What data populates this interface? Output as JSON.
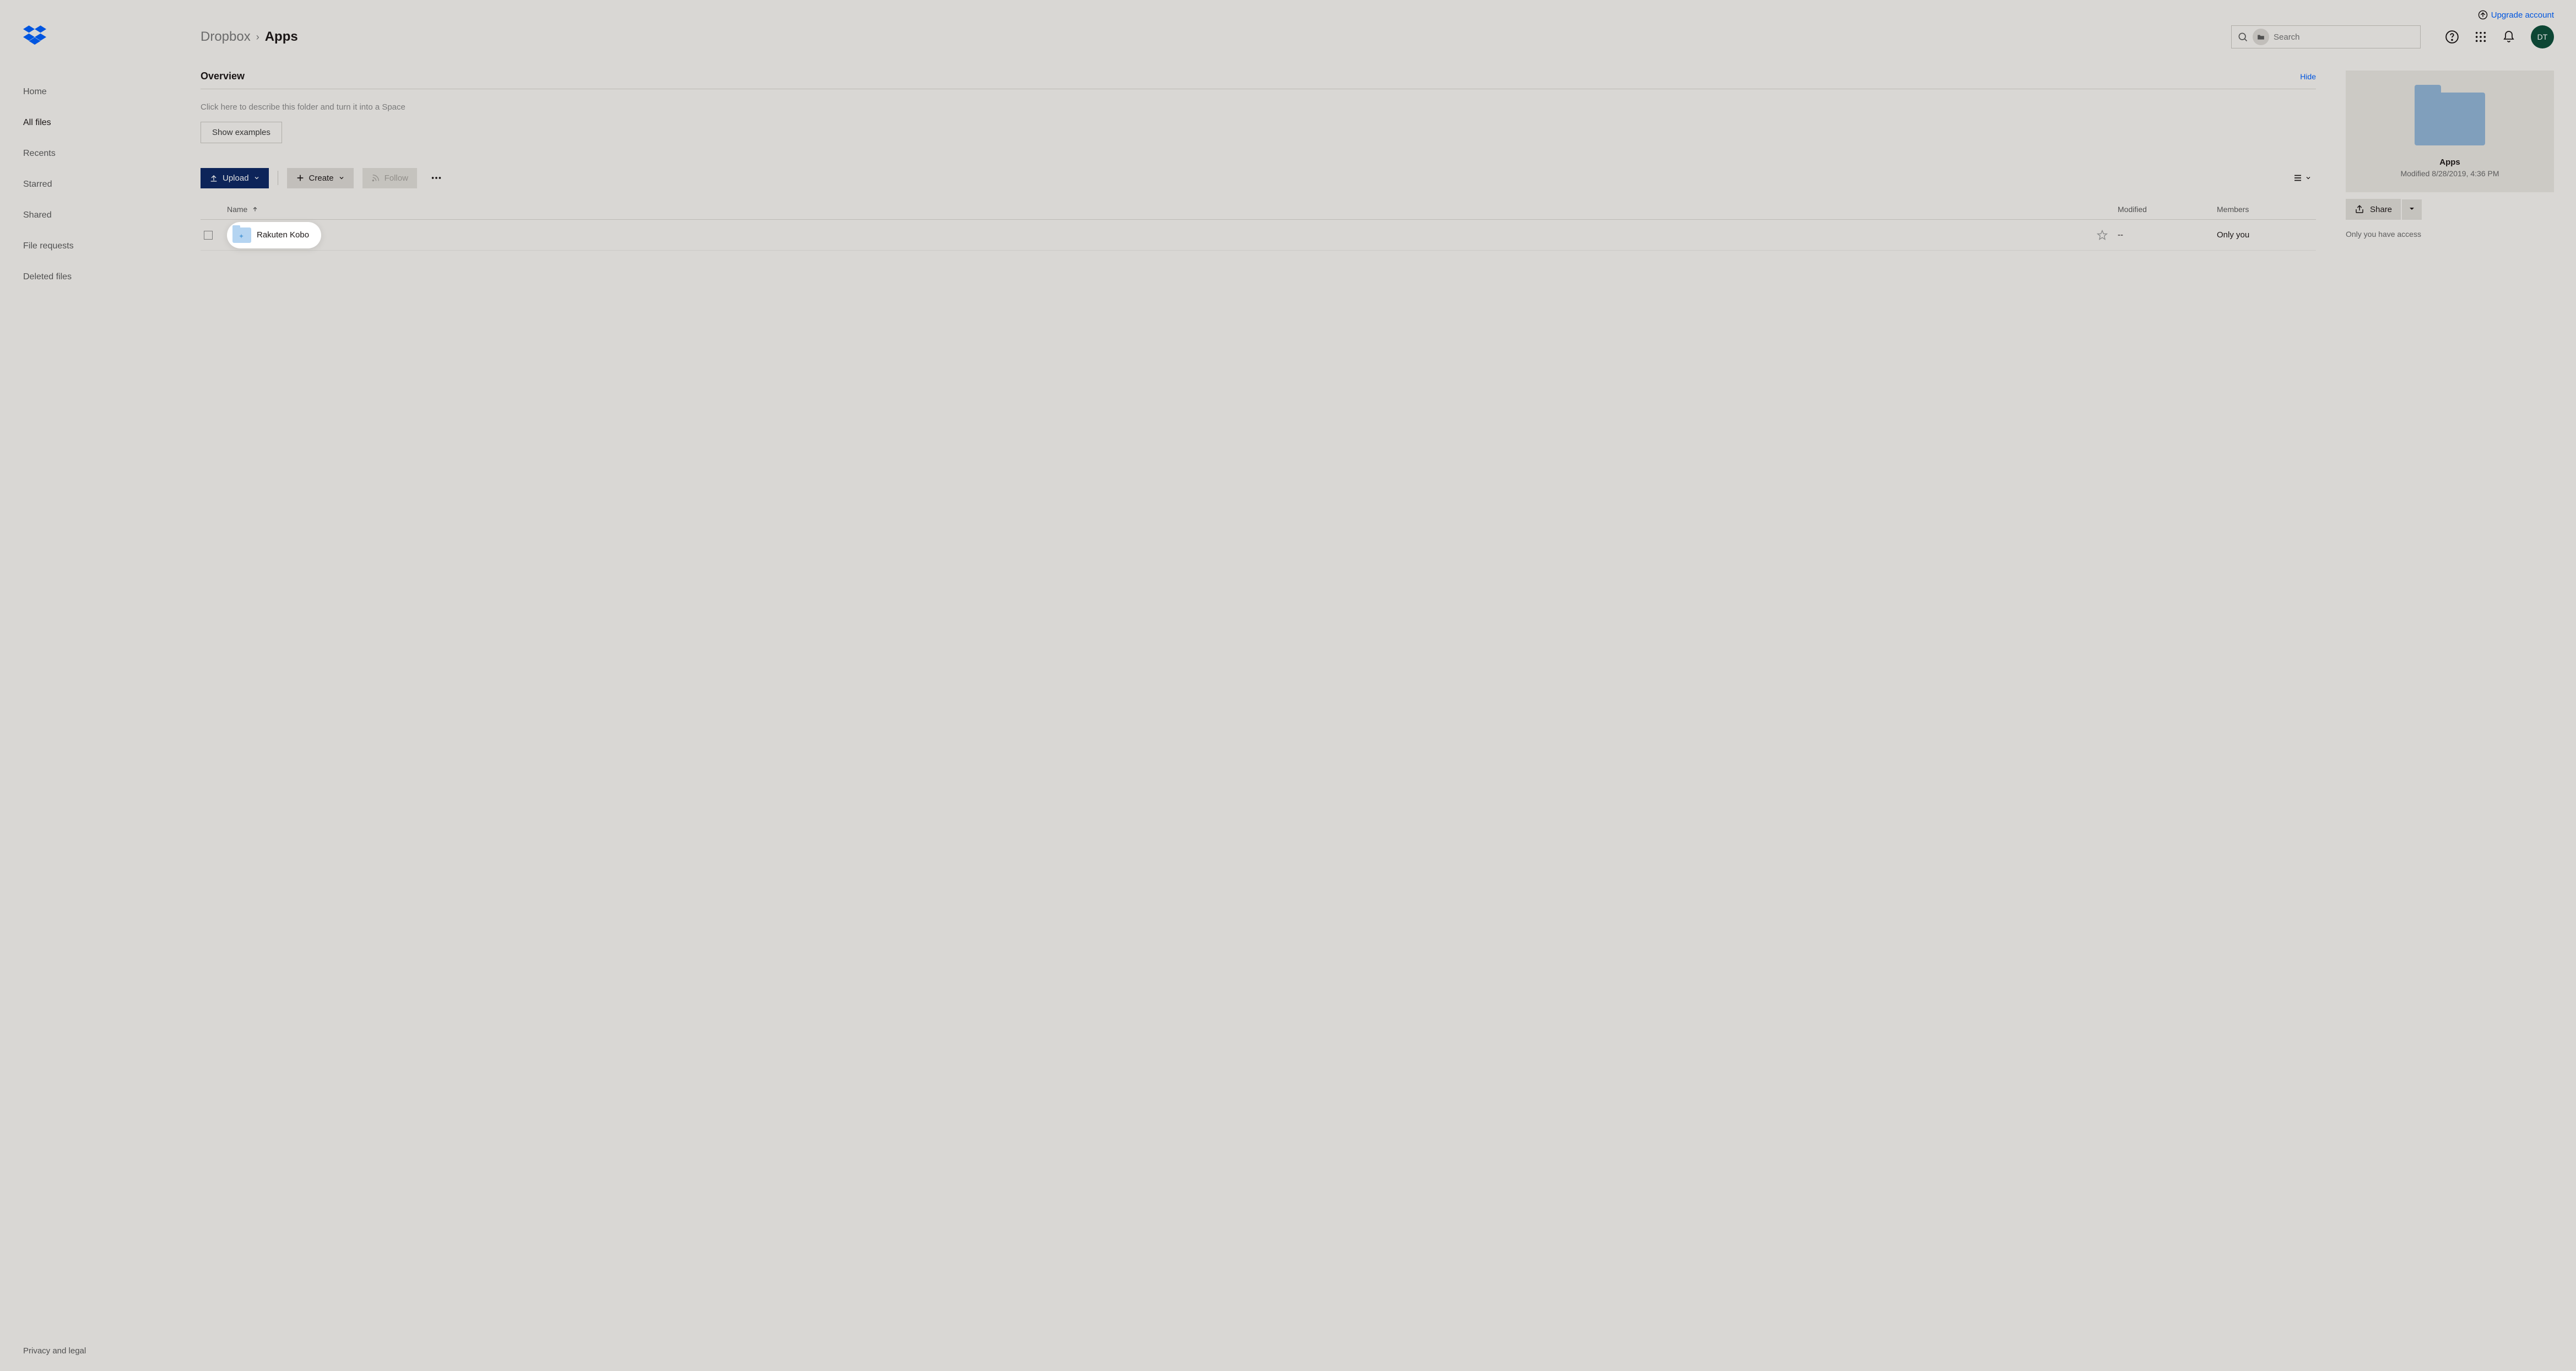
{
  "topbar": {
    "upgrade_label": "Upgrade account"
  },
  "sidebar": {
    "items": [
      {
        "label": "Home"
      },
      {
        "label": "All files"
      },
      {
        "label": "Recents"
      },
      {
        "label": "Starred"
      },
      {
        "label": "Shared"
      },
      {
        "label": "File requests"
      },
      {
        "label": "Deleted files"
      }
    ],
    "footer": "Privacy and legal"
  },
  "breadcrumb": {
    "root": "Dropbox",
    "current": "Apps"
  },
  "search": {
    "placeholder": "Search"
  },
  "avatar": {
    "initials": "DT"
  },
  "overview": {
    "title": "Overview",
    "hide_label": "Hide",
    "description_placeholder": "Click here to describe this folder and turn it into a Space",
    "show_examples_label": "Show examples"
  },
  "toolbar": {
    "upload_label": "Upload",
    "create_label": "Create",
    "follow_label": "Follow"
  },
  "table": {
    "columns": {
      "name": "Name",
      "modified": "Modified",
      "members": "Members"
    },
    "rows": [
      {
        "name": "Rakuten Kobo",
        "modified": "--",
        "members": "Only you"
      }
    ]
  },
  "right_panel": {
    "title": "Apps",
    "modified": "Modified 8/28/2019, 4:36 PM",
    "share_label": "Share",
    "access_text": "Only you have access"
  }
}
